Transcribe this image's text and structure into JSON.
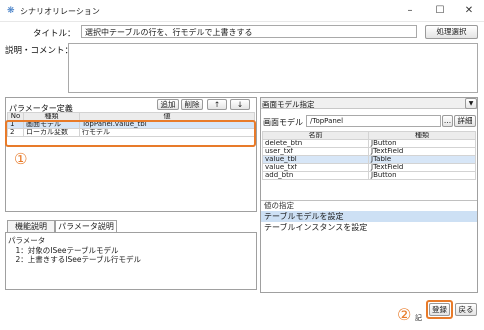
{
  "window": {
    "title": "シナリオリレーション",
    "minimize_glyph": "–",
    "maximize_glyph": "☐",
    "close_glyph": "✕"
  },
  "form": {
    "title_label": "タイトル：",
    "title_value": "選択中テーブルの行を、行モデルで上書きする",
    "title_select_button": "処理選択",
    "desc_label": "説明・コメント：",
    "desc_value": ""
  },
  "params": {
    "header_label": "パラメーター定義",
    "add_button": "追加",
    "delete_button": "削除",
    "up_button": "↑",
    "down_button": "↓",
    "columns": [
      "No",
      "種類",
      "値"
    ],
    "rows": [
      {
        "no": "1",
        "type": "画面モデル",
        "value": "TopPanel.value_tbl"
      },
      {
        "no": "2",
        "type": "ローカル変数",
        "value": "行モデル"
      }
    ]
  },
  "annotations": {
    "one": "①",
    "two": "②"
  },
  "tabs": [
    "機能説明",
    "パラメータ説明"
  ],
  "param_desc": {
    "line1": "パラメータ",
    "line2": "　1：対象のISeeテーブルモデル",
    "line3": "　2：上書きするISeeテーブル行モデル"
  },
  "screen_model": {
    "header_title": "画面モデル指定",
    "dropdown_glyph": "▼",
    "model_label": "画面モデル",
    "model_value": "/TopPanel",
    "browse_button": "...",
    "detail_button": "詳細",
    "columns": [
      "名前",
      "種類"
    ],
    "rows": [
      {
        "name": "delete_btn",
        "kind": "JButton"
      },
      {
        "name": "user_txf",
        "kind": "JTextField"
      },
      {
        "name": "value_tbl",
        "kind": "JTable",
        "selected": true
      },
      {
        "name": "value_txf",
        "kind": "JTextField"
      },
      {
        "name": "add_btn",
        "kind": "JButton"
      }
    ]
  },
  "type_spec": {
    "header": "値の指定",
    "items": [
      "テーブルモデルを設定",
      "テーブルインスタンスを設定"
    ]
  },
  "footer": {
    "register_button": "登録",
    "back_button": "戻る",
    "caption": "記"
  }
}
